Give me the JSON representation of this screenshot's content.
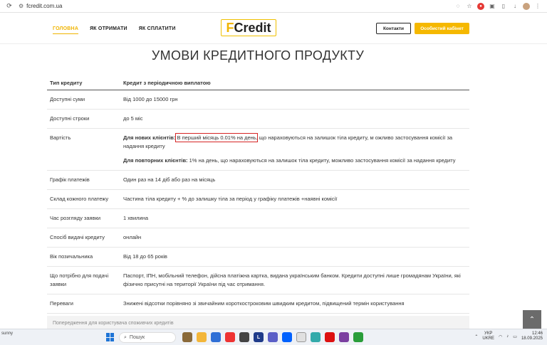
{
  "browser": {
    "url": "fcredit.com.ua"
  },
  "header": {
    "menu": [
      "ГОЛОВНА",
      "ЯК ОТРИМАТИ",
      "ЯК СПЛАТИТИ"
    ],
    "logo_letter": "F",
    "logo_rest": "Credit",
    "contacts_label": "Контакти",
    "cabinet_label": "Особистий кабінет"
  },
  "page_title": "УМОВИ КРЕДИТНОГО ПРОДУКТУ",
  "table": {
    "head": [
      "Тип кредиту",
      "Кредит з періодичною виплатою"
    ],
    "rows": [
      {
        "label": "Доступні суми",
        "value": "Від 1000 до 15000 грн"
      },
      {
        "label": "Доступні строки",
        "value": "до 5 міс"
      },
      {
        "label": "Вартість",
        "new_clients_label": "Для нових клієнтів:",
        "new_clients_highlight": "В перший місяць 0.01% на день",
        "new_clients_rest": ", що нараховуються на залишок тіла кредиту, м ожливо застосування комісії за надання кредиту",
        "repeat_clients_label": "Для повторних клієнтів:",
        "repeat_clients_rest": " 1% на день, що нараховуються на залишок тіла кредиту, можливо застосування комісії за надання кредиту"
      },
      {
        "label": "Графік платежів",
        "value": "Один раз на 14 діб або раз на місяць"
      },
      {
        "label": "Склад кожного платежу",
        "value": "Частина тіла кредиту + % до залишку тіла за період у графіку платежів +наявні комісії"
      },
      {
        "label": "Час розгляду заявки",
        "value": "1 хвилина"
      },
      {
        "label": "Спосіб видачі кредиту",
        "value": "онлайн"
      },
      {
        "label": "Вік позичальника",
        "value": "Від 18 до 65 років"
      },
      {
        "label": "Що потрібно для подачі заявки",
        "value": "Паспорт, ІПН, мобільний телефон, дійсна платіжна картка, видана українським банком. Кредити доступні лише громадянам України, які фізично присутні на території України під час отримання."
      },
      {
        "label": "Переваги",
        "value": "Знижені відсотки порівняно зі звичайним короткостроковим швидким кредитом, підвищений термін користування"
      }
    ]
  },
  "warning_text": "Попередження для користувача споживчих кредитів",
  "taskbar": {
    "weather": "sunny",
    "search_placeholder": "Пошук",
    "lang_top": "УКР",
    "lang_bottom": "UKRE",
    "time": "12:46",
    "date": "18.09.2025"
  }
}
